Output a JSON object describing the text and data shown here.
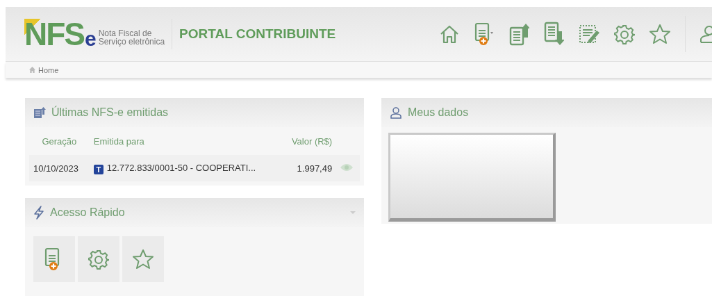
{
  "header": {
    "logo": {
      "mark": "NFS",
      "mark_e": "e",
      "tagline": [
        "Nota Fiscal de",
        "Serviço eletrônica"
      ]
    },
    "title": "PORTAL CONTRIBUINTE"
  },
  "breadcrumb": {
    "label": "Home"
  },
  "last_invoices": {
    "title": "Últimas NFS-e emitidas",
    "columns": [
      "Geração",
      "Emitida para",
      "Valor (R$)"
    ],
    "rows": [
      {
        "date": "10/10/2023",
        "badge": "T",
        "recipient": "12.772.833/0001-50 - COOPERATI...",
        "value": "1.997,49"
      }
    ]
  },
  "quick_access": {
    "title": "Acesso Rápido"
  },
  "my_data": {
    "title": "Meus dados"
  }
}
